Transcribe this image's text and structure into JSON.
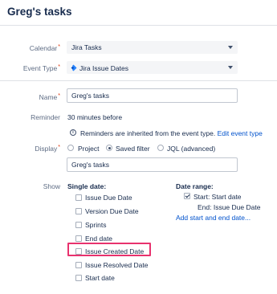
{
  "header": {
    "title": "Greg's tasks"
  },
  "form": {
    "calendar": {
      "label": "Calendar",
      "required": "*",
      "value": "Jira Tasks"
    },
    "event_type": {
      "label": "Event Type",
      "required": "*",
      "value": "Jira Issue Dates",
      "icon": "jira-icon"
    },
    "name": {
      "label": "Name",
      "required": "*",
      "value": "Greg's tasks"
    },
    "reminder": {
      "label": "Reminder",
      "value": "30 minutes before",
      "info": "Reminders are inherited from the event type.",
      "edit_link": "Edit event type"
    },
    "display": {
      "label": "Display",
      "required": "*",
      "options": [
        "Project",
        "Saved filter",
        "JQL (advanced)"
      ],
      "selected": "Saved filter",
      "value": "Greg's tasks"
    },
    "show": {
      "label": "Show",
      "single_date": {
        "heading": "Single date:",
        "options": [
          {
            "label": "Issue Due Date",
            "checked": false
          },
          {
            "label": "Version Due Date",
            "checked": false
          },
          {
            "label": "Sprints",
            "checked": false
          },
          {
            "label": "End date",
            "checked": false
          },
          {
            "label": "Issue Created Date",
            "checked": false,
            "highlighted": true
          },
          {
            "label": "Issue Resolved Date",
            "checked": false
          },
          {
            "label": "Start date",
            "checked": false
          }
        ]
      },
      "date_range": {
        "heading": "Date range:",
        "start": "Start: Start date",
        "end": "End: Issue Due Date",
        "add_link": "Add start and end date..."
      }
    }
  },
  "colors": {
    "highlight": "#e8326e",
    "link": "#0052cc",
    "required": "#de350b"
  }
}
